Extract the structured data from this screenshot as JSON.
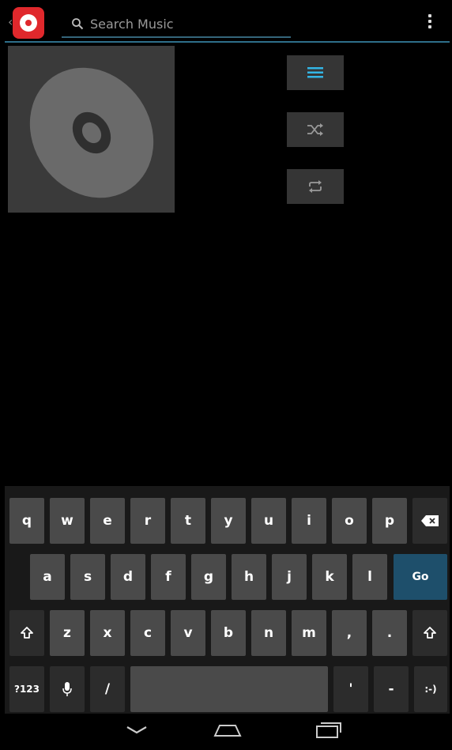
{
  "actionbar": {
    "search_placeholder": "Search Music",
    "app_icon": "music-app-icon",
    "back_icon": "chevron-left-icon",
    "search_icon": "search-icon",
    "overflow_icon": "more-vertical-icon"
  },
  "main": {
    "album_art_icon": "cd-disc-icon",
    "buttons": [
      {
        "icon": "queue-list-icon",
        "color": "#33b5e5"
      },
      {
        "icon": "shuffle-icon",
        "color": "#9a9a9a"
      },
      {
        "icon": "repeat-icon",
        "color": "#9a9a9a"
      }
    ]
  },
  "keyboard": {
    "row1": [
      "q",
      "w",
      "e",
      "r",
      "t",
      "y",
      "u",
      "i",
      "o",
      "p"
    ],
    "row2": [
      "a",
      "s",
      "d",
      "f",
      "g",
      "h",
      "j",
      "k",
      "l"
    ],
    "row3": [
      "z",
      "x",
      "c",
      "v",
      "b",
      "n",
      "m",
      ",",
      "."
    ],
    "go_label": "Go",
    "symbols_label": "?123",
    "slash_label": "/",
    "apostrophe_label": "'",
    "dash_label": "-",
    "smiley_label": ":-)",
    "backspace_icon": "backspace-icon",
    "shift_icon": "shift-icon",
    "mic_icon": "microphone-icon",
    "accent_color": "#1e4f6b"
  },
  "navbar": {
    "back_icon": "nav-back-icon",
    "home_icon": "nav-home-icon",
    "recents_icon": "nav-recents-icon"
  }
}
